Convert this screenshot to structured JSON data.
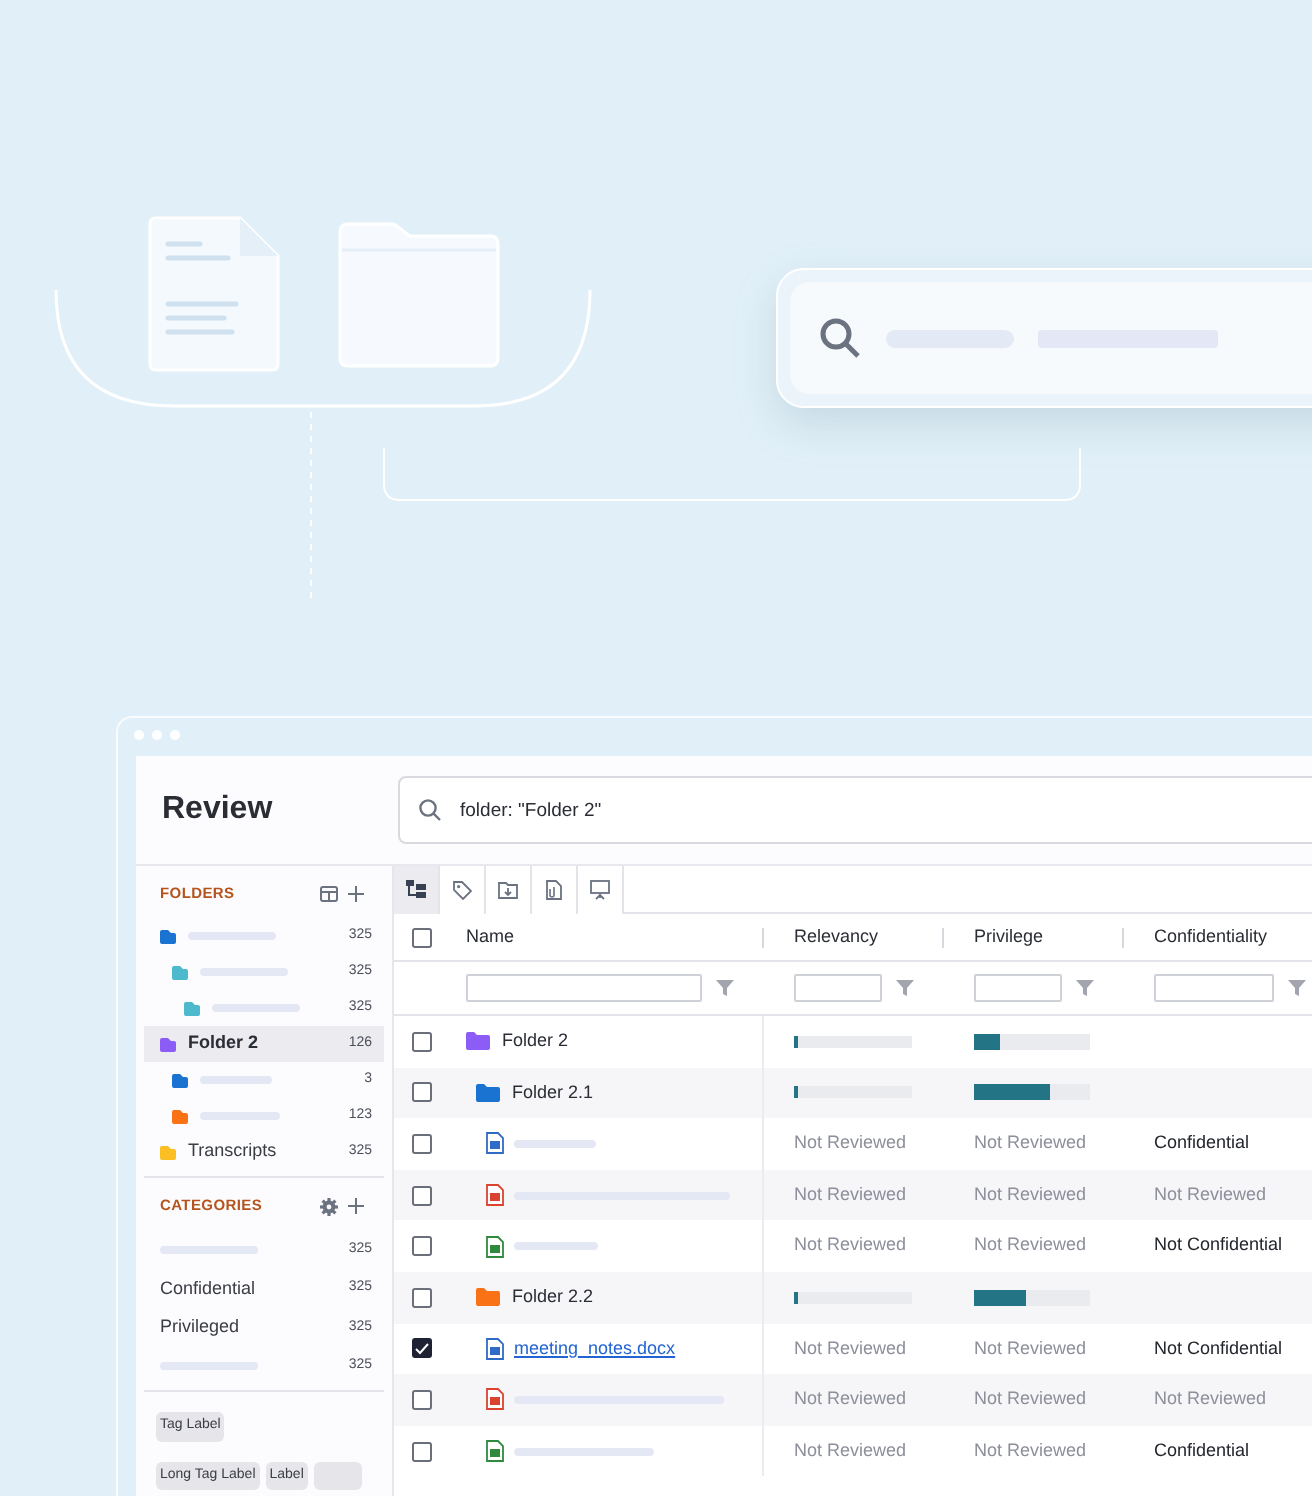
{
  "app": {
    "title": "Review",
    "search": {
      "value": "folder: \"Folder 2\""
    }
  },
  "sidebar": {
    "folders": {
      "title": "FOLDERS",
      "items": [
        {
          "color": "#1a73d1",
          "count": "325",
          "selected": false,
          "children": [
            {
              "color": "#4cb9cc",
              "count": "325",
              "selected": false,
              "children": [
                {
                  "color": "#4cb9cc",
                  "count": "325",
                  "selected": false
                }
              ]
            }
          ]
        },
        {
          "name": "Folder 2",
          "color": "#8b5cf6",
          "count": "126",
          "selected": true,
          "children": [
            {
              "color": "#1a73d1",
              "count": "3",
              "selected": false
            },
            {
              "color": "#f97316",
              "count": "123",
              "selected": false
            }
          ]
        },
        {
          "name": "Transcripts",
          "color": "#fbbf24",
          "count": "325",
          "selected": false
        }
      ]
    },
    "categories": {
      "title": "CATEGORIES",
      "items": [
        {
          "count": "325"
        },
        {
          "name": "Confidential",
          "count": "325"
        },
        {
          "name": "Privileged",
          "count": "325"
        },
        {
          "count": "325"
        }
      ]
    },
    "tags": [
      "Tag Label",
      "Long Tag Label",
      "Label"
    ]
  },
  "toolbar": {
    "tabs": [
      {
        "selected": true
      },
      {
        "selected": false
      },
      {
        "selected": false
      },
      {
        "selected": false
      },
      {
        "selected": false
      }
    ]
  },
  "table": {
    "columns": [
      "Name",
      "Relevancy",
      "Privilege",
      "Confidentiality"
    ],
    "select_all": {
      "checked": false
    },
    "rows": [
      {
        "kind": "folder",
        "name": "Folder 2",
        "color": "#8b5cf6",
        "checked": false,
        "relevancy": {
          "level": 0.04
        },
        "privilege": {
          "level": 0.22
        },
        "children": [
          {
            "kind": "folder",
            "name": "Folder 2.1",
            "color": "#1a73d1",
            "checked": false,
            "relevancy": {
              "level": 0.04
            },
            "privilege": {
              "level": 0.65
            },
            "children": [
              {
                "kind": "word",
                "checked": false,
                "relevancy": {
                  "text": "Not Reviewed",
                  "reviewed": false
                },
                "privilege": {
                  "text": "Not Reviewed",
                  "reviewed": false
                },
                "confidentiality": {
                  "text": "Confidential",
                  "reviewed": true
                }
              },
              {
                "kind": "pdf",
                "checked": false,
                "relevancy": {
                  "text": "Not Reviewed",
                  "reviewed": false
                },
                "privilege": {
                  "text": "Not Reviewed",
                  "reviewed": false
                },
                "confidentiality": {
                  "text": "Not Reviewed",
                  "reviewed": false
                }
              },
              {
                "kind": "excel",
                "checked": false,
                "relevancy": {
                  "text": "Not Reviewed",
                  "reviewed": false
                },
                "privilege": {
                  "text": "Not Reviewed",
                  "reviewed": false
                },
                "confidentiality": {
                  "text": "Not Confidential",
                  "reviewed": true
                }
              }
            ]
          },
          {
            "kind": "folder",
            "name": "Folder 2.2",
            "color": "#f97316",
            "checked": false,
            "relevancy": {
              "level": 0.04
            },
            "privilege": {
              "level": 0.45
            },
            "children": [
              {
                "kind": "word",
                "name": "meeting_notes.docx",
                "checked": true,
                "relevancy": {
                  "text": "Not Reviewed",
                  "reviewed": false
                },
                "privilege": {
                  "text": "Not Reviewed",
                  "reviewed": false
                },
                "confidentiality": {
                  "text": "Not Confidential",
                  "reviewed": true
                }
              },
              {
                "kind": "pdf",
                "checked": false,
                "relevancy": {
                  "text": "Not Reviewed",
                  "reviewed": false
                },
                "privilege": {
                  "text": "Not Reviewed",
                  "reviewed": false
                },
                "confidentiality": {
                  "text": "Not Reviewed",
                  "reviewed": false
                }
              },
              {
                "kind": "excel",
                "checked": false,
                "relevancy": {
                  "text": "Not Reviewed",
                  "reviewed": false
                },
                "privilege": {
                  "text": "Not Reviewed",
                  "reviewed": false
                },
                "confidentiality": {
                  "text": "Confidential",
                  "reviewed": true
                }
              }
            ]
          }
        ]
      }
    ]
  }
}
